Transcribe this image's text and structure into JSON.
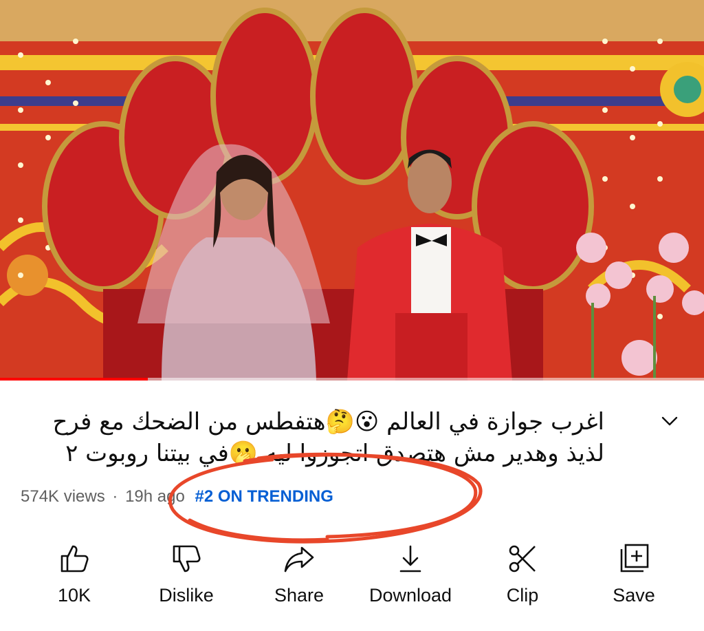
{
  "video": {
    "progress_percent": 21
  },
  "title": "اغرب جوازة في العالم 😮🤔هتفطس من الضحك مع فرح لذيذ وهدير مش هتصدق اتجوزوا ليه 🫢في بيتنا روبوت ٢",
  "meta": {
    "views": "574K views",
    "separator": "·",
    "age": "19h ago",
    "trending": "#2 ON TRENDING"
  },
  "actions": [
    {
      "label": "10K",
      "icon": "thumbs-up-icon"
    },
    {
      "label": "Dislike",
      "icon": "thumbs-down-icon"
    },
    {
      "label": "Share",
      "icon": "share-icon"
    },
    {
      "label": "Download",
      "icon": "download-icon"
    },
    {
      "label": "Clip",
      "icon": "scissors-icon"
    },
    {
      "label": "Save",
      "icon": "save-playlist-icon"
    }
  ],
  "colors": {
    "trending": "#065fd4",
    "annotation": "#e8472a",
    "progress": "#ff0000"
  }
}
